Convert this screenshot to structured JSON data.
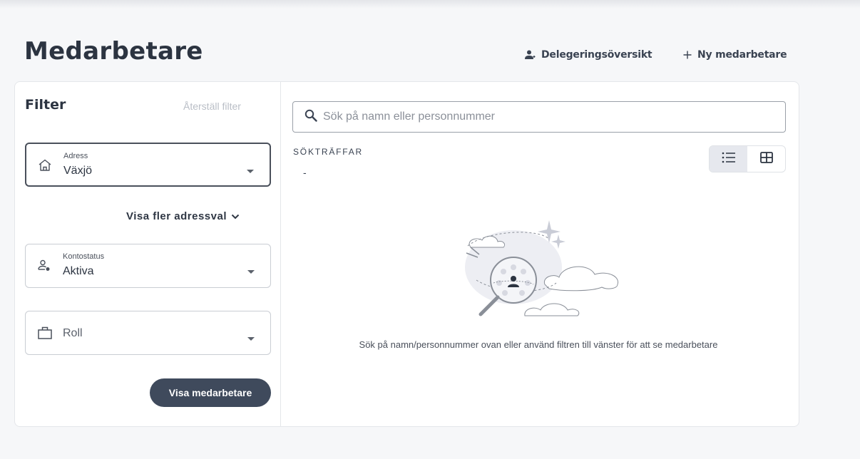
{
  "page": {
    "title": "Medarbetare"
  },
  "header_actions": {
    "delegation_label": "Delegeringsöversikt",
    "new_employee_label": "Ny medarbetare"
  },
  "filter": {
    "title": "Filter",
    "reset_label": "Återställ filter",
    "address": {
      "label": "Adress",
      "value": "Växjö",
      "icon": "home-icon"
    },
    "more_address_label": "Visa fler adressval",
    "account_status": {
      "label": "Kontostatus",
      "value": "Aktiva",
      "icon": "person-status-icon"
    },
    "role": {
      "placeholder": "Roll",
      "icon": "briefcase-icon"
    },
    "show_button_label": "Visa medarbetare"
  },
  "search": {
    "placeholder": "Sök på namn eller personnummer",
    "value": ""
  },
  "results": {
    "label": "SÖKTRÄFFAR",
    "value": "-",
    "view_modes": [
      {
        "name": "list",
        "icon": "list-icon",
        "selected": true
      },
      {
        "name": "grid",
        "icon": "grid-icon",
        "selected": false
      }
    ],
    "empty_message": "Sök på namn/personnummer ovan eller använd filtren till vänster för att se medarbetare"
  },
  "colors": {
    "background": "#f6f7f9",
    "primary_button": "#3f4a5c",
    "text": "#2c3441",
    "muted": "#b9bec6"
  }
}
